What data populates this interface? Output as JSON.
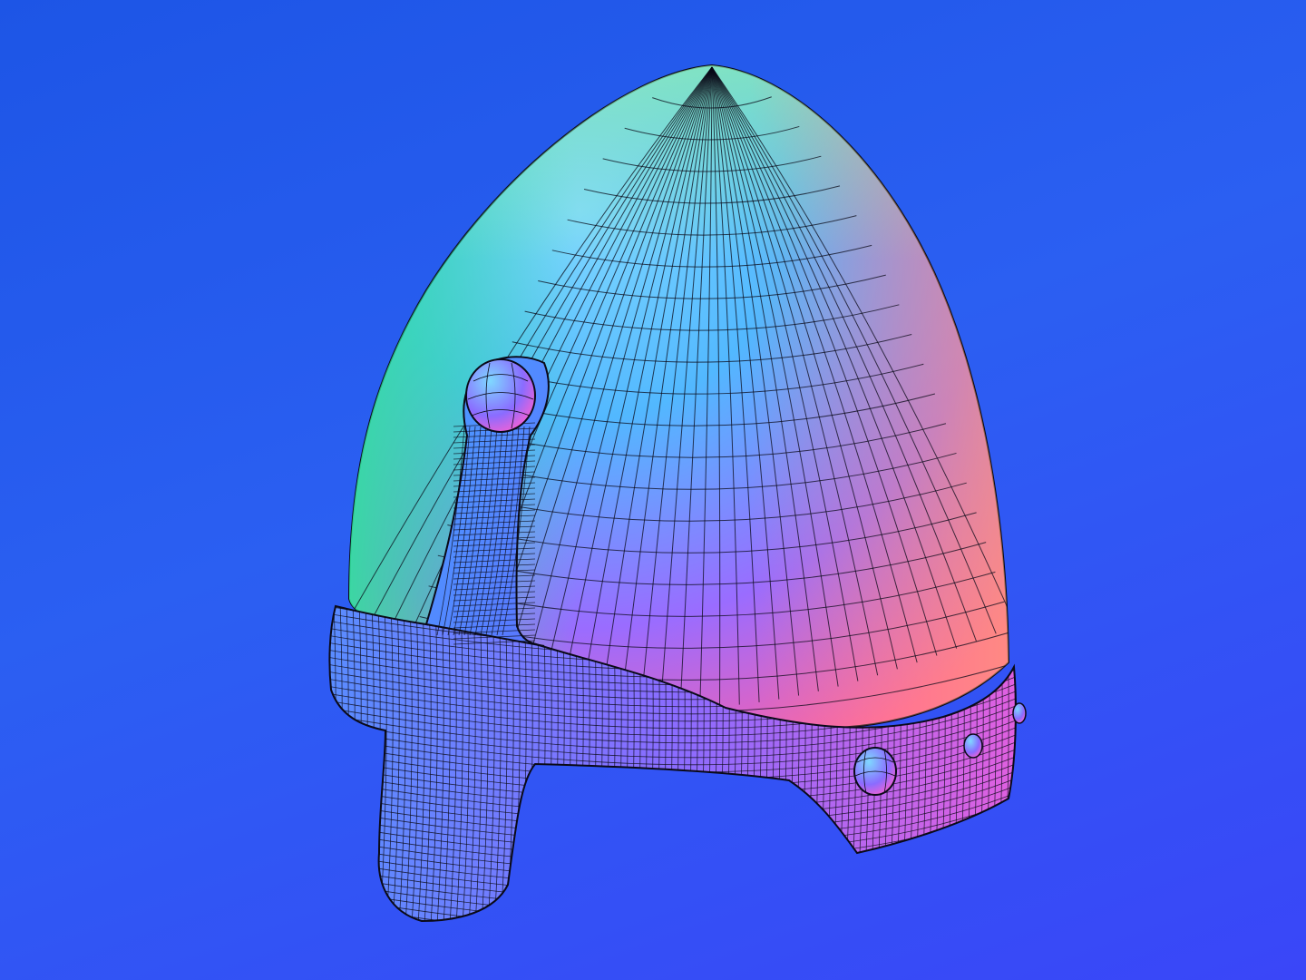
{
  "scene": {
    "subject": "helmet-mesh",
    "render_style": "normal-map shading with wireframe overlay",
    "colors": {
      "background_top": "#1d55e6",
      "background_bottom": "#3a46f8",
      "shade_green": "#2fe39a",
      "shade_cyan": "#52c8ff",
      "shade_blue": "#4a7dff",
      "shade_purple": "#a35cff",
      "shade_pink": "#ff5fa8",
      "shade_orange": "#ffb080",
      "wire": "#0a0a18"
    }
  }
}
